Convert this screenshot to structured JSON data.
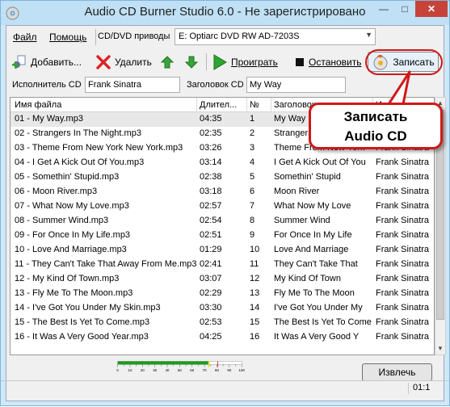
{
  "window": {
    "title": "Audio CD Burner Studio 6.0 - Не зарегистрировано"
  },
  "menu": {
    "file": "Файл",
    "help": "Помощь"
  },
  "drive": {
    "label": "CD/DVD приводы",
    "selected": "E: Optiarc DVD RW AD-7203S"
  },
  "toolbar": {
    "add": "Добавить...",
    "delete": "Удалить",
    "play": "Проиграть",
    "stop": "Остановить",
    "burn": "Записать"
  },
  "fields": {
    "artist_label": "Исполнитель CD",
    "artist_value": "Frank Sinatra",
    "title_label": "Заголовок CD",
    "title_value": "My Way"
  },
  "table": {
    "columns": [
      "Имя файла",
      "Длител...",
      "№",
      "Заголовок",
      "Исполнитель"
    ],
    "rows": [
      [
        "01 - My Way.mp3",
        "04:35",
        "1",
        "My Way",
        "Frank Sinatra"
      ],
      [
        "02 - Strangers In The Night.mp3",
        "02:35",
        "2",
        "Strangers In The Night",
        "Frank Sinatra"
      ],
      [
        "03 - Theme From New York New York.mp3",
        "03:26",
        "3",
        "Theme From New York",
        "Frank Sinatra"
      ],
      [
        "04 - I Get A Kick Out Of You.mp3",
        "03:14",
        "4",
        "I Get A Kick Out Of You",
        "Frank Sinatra"
      ],
      [
        "05 - Somethin' Stupid.mp3",
        "02:38",
        "5",
        "Somethin' Stupid",
        "Frank Sinatra"
      ],
      [
        "06 - Moon River.mp3",
        "03:18",
        "6",
        "Moon River",
        "Frank Sinatra"
      ],
      [
        "07 - What Now My Love.mp3",
        "02:57",
        "7",
        "What Now My Love",
        "Frank Sinatra"
      ],
      [
        "08 - Summer Wind.mp3",
        "02:54",
        "8",
        "Summer Wind",
        "Frank Sinatra"
      ],
      [
        "09 - For Once In My Life.mp3",
        "02:51",
        "9",
        "For Once In My Life",
        "Frank Sinatra"
      ],
      [
        "10 - Love And Marriage.mp3",
        "01:29",
        "10",
        "Love And Marriage",
        "Frank Sinatra"
      ],
      [
        "11 - They Can't Take That Away From Me.mp3",
        "02:41",
        "11",
        "They Can't Take That",
        "Frank Sinatra"
      ],
      [
        "12 - My Kind Of Town.mp3",
        "03:07",
        "12",
        "My Kind Of Town",
        "Frank Sinatra"
      ],
      [
        "13 - Fly Me To The Moon.mp3",
        "02:29",
        "13",
        "Fly Me To The Moon",
        "Frank Sinatra"
      ],
      [
        "14 - I've Got You Under My Skin.mp3",
        "03:30",
        "14",
        "I've Got You Under My",
        "Frank Sinatra"
      ],
      [
        "15 - The Best Is Yet To Come.mp3",
        "02:53",
        "15",
        "The Best Is Yet To Come",
        "Frank Sinatra"
      ],
      [
        "16 - It Was A Very Good Year.mp3",
        "04:25",
        "16",
        "It Was A Very Good Y",
        "Frank Sinatra"
      ]
    ]
  },
  "callout": {
    "line1": "Записать",
    "line2": "Audio CD"
  },
  "capacity": {
    "filled_fraction": 0.735,
    "scale_labels": [
      "0",
      "10",
      "20",
      "30",
      "40",
      "50",
      "60",
      "70",
      "80",
      "90",
      "100"
    ],
    "fill_color": "#1f9a1f",
    "marker_color": "#e6e600",
    "limit_color": "#d01818"
  },
  "eject": "Извлечь",
  "status": {
    "position": "01:1"
  }
}
